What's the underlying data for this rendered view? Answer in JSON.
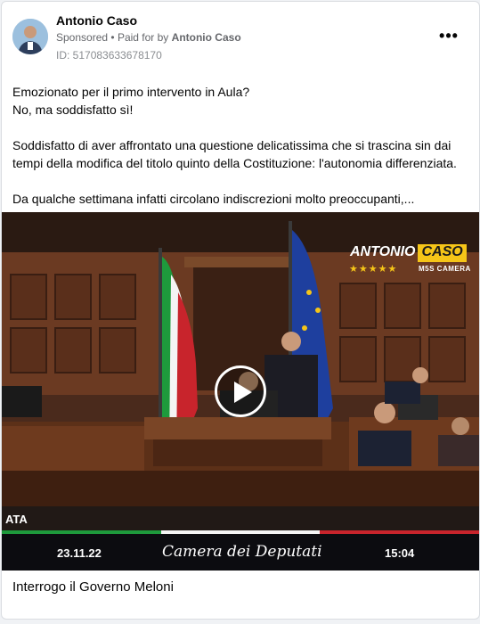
{
  "post": {
    "author": "Antonio Caso",
    "sponsored_label": "Sponsored",
    "paid_prefix": "Paid for by",
    "paid_by": "Antonio Caso",
    "ad_id": "ID: 517083633678170",
    "more_label": "•••",
    "text_lines": [
      "Emozionato per il primo intervento in Aula?",
      "No, ma soddisfatto sì!",
      "Soddisfatto di aver affrontato una questione delicatissima che si trascina sin dai tempi della modifica del titolo quinto della Costituzione: l'autonomia differenziata.",
      "Da qualche settimana infatti circolano indiscrezioni molto preoccupanti,..."
    ],
    "caption": "Interrogo il Governo Meloni"
  },
  "video": {
    "logo_name_white": "ANTONIO",
    "logo_name_yellow": "CASO",
    "logo_stars": "★★★★★",
    "logo_sub": "M5S CAMERA",
    "ticker_left": "ATA",
    "date": "23.11.22",
    "chamber": "Camera dei Deputati",
    "time": "15:04"
  },
  "colors": {
    "accent_yellow": "#f5c518",
    "flag_green": "#1e9a3c",
    "flag_white": "#f4f4f4",
    "flag_red": "#c8242c",
    "eu_blue": "#1e3f9e"
  }
}
